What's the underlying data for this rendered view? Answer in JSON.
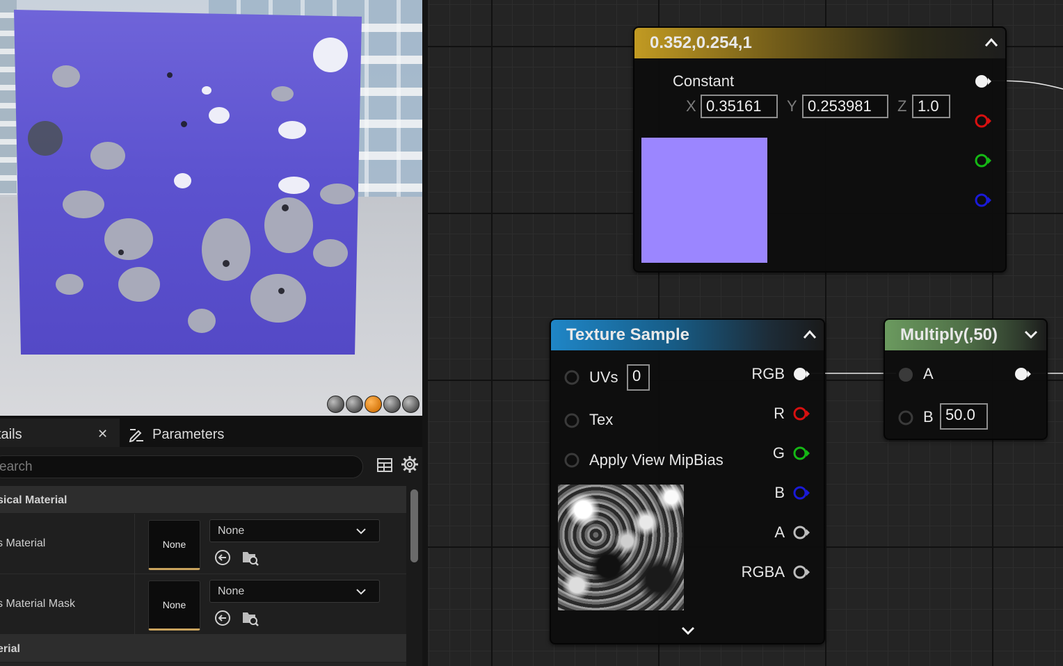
{
  "viewport": {
    "view_modes": [
      "cylinder",
      "sphere",
      "plane",
      "cube",
      "custom-mesh"
    ],
    "active_view_mode": "plane"
  },
  "details_panel": {
    "tabs": [
      {
        "label": "tails",
        "closable": true
      },
      {
        "label": "Parameters",
        "closable": false
      }
    ],
    "search_placeholder": "earch",
    "categories": [
      {
        "label": "sical Material",
        "properties": [
          {
            "name": "s Material",
            "thumbnail_label": "None",
            "value": "None"
          },
          {
            "name": "s Material Mask",
            "thumbnail_label": "None",
            "value": "None"
          }
        ]
      },
      {
        "label": "erial",
        "properties": []
      }
    ]
  },
  "graph": {
    "constant_node": {
      "title": "0.352,0.254,1",
      "label": "Constant",
      "x_axis": "X",
      "x_value": "0.35161",
      "y_axis": "Y",
      "y_value": "0.253981",
      "z_axis": "Z",
      "z_value": "1.0",
      "swatch_color": "#9b86ff",
      "header_color": "#c19a22"
    },
    "texture_node": {
      "title": "Texture Sample",
      "inputs": [
        {
          "label": "UVs",
          "value": "0"
        },
        {
          "label": "Tex"
        },
        {
          "label": "Apply View MipBias"
        }
      ],
      "outputs": [
        "RGB",
        "R",
        "G",
        "B",
        "A",
        "RGBA"
      ],
      "header_color": "#1f86c7"
    },
    "multiply_node": {
      "title": "Multiply(,50)",
      "input_a": "A",
      "input_b": "B",
      "b_value": "50.0",
      "header_color": "#6b9a5f"
    },
    "pin_colors": {
      "white": "#f2f2f2",
      "red": "#d81010",
      "green": "#15b815",
      "blue": "#1a1ad8",
      "grey": "#bdbdbd"
    }
  }
}
